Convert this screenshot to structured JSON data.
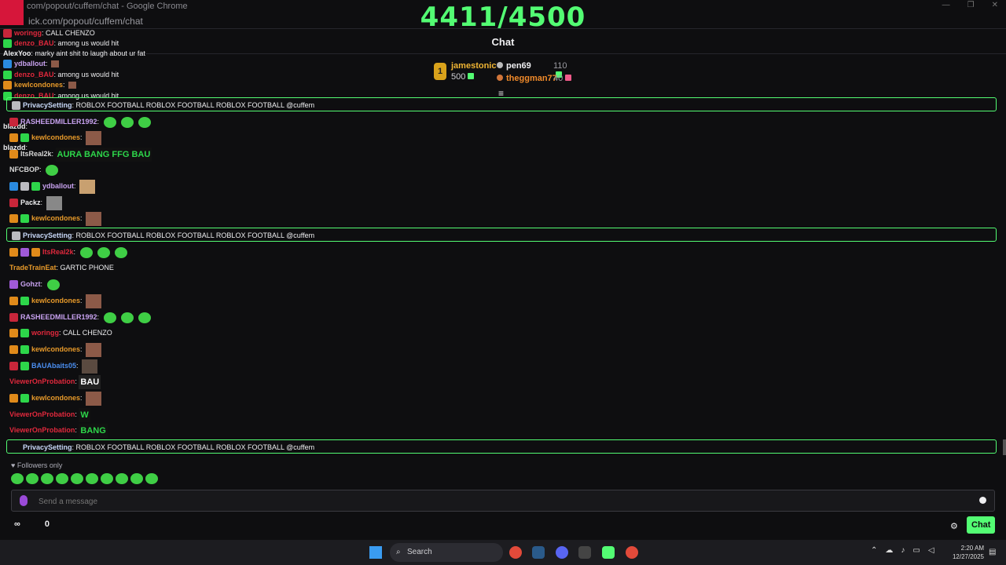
{
  "browser": {
    "title": "com/popout/cuffem/chat - Google Chrome",
    "address": "ick.com/popout/cuffem/chat",
    "window_controls": [
      "—",
      "❐",
      "✕"
    ]
  },
  "overlay": {
    "counter": "4411/4500"
  },
  "header": {
    "title": "Chat"
  },
  "leaderboard": {
    "first": {
      "rank": "1",
      "name": "jamestonic",
      "amount": "500"
    },
    "second": {
      "name": "pen69",
      "amount": "110"
    },
    "third": {
      "name": "theggman77",
      "amount": "40"
    },
    "expand_icon": "≡"
  },
  "overlay_chat": [
    {
      "name": "woringg",
      "text": "CALL CHENZO"
    },
    {
      "name": "denzo_BAU",
      "text": "among us would hit"
    },
    {
      "name": "AlexYoo",
      "text": "marky aint shit to laugh about ur fat"
    },
    {
      "name": "ydballout",
      "text": ""
    },
    {
      "name": "denzo_BAU",
      "text": "among us would hit"
    },
    {
      "name": "kewlcondones",
      "text": ""
    },
    {
      "name": "denzo_BAU",
      "text": "among us would hit"
    },
    {
      "name": "RASHEEDMILLER1992",
      "text": ""
    },
    {
      "name": "blazdd",
      "text": ""
    },
    {
      "name": "blazdd",
      "text": ""
    },
    {
      "name": "NFCBOP",
      "text": ""
    }
  ],
  "chat": {
    "pinned_text": "ROBLOX FOOTBALL ROBLOX FOOTBALL ROBLOX FOOTBALL @cuffem",
    "messages": [
      {
        "name": "RASHEEDMILLER1992",
        "color": "#c8a2f0",
        "text": ""
      },
      {
        "name": "kewlcondones",
        "color": "#e89a2a",
        "text": ""
      },
      {
        "name": "ItsReal2k",
        "color": "#d8d8d8",
        "text": "AURA BANG FFG BAU"
      },
      {
        "name": "NFCBOP",
        "color": "#d8d8d8",
        "text": ""
      },
      {
        "name": "ydballout",
        "color": "#c8a2f0",
        "text": ""
      },
      {
        "name": "Packz",
        "color": "#efeff1",
        "text": ""
      },
      {
        "name": "kewlcondones",
        "color": "#e89a2a",
        "text": ""
      },
      {
        "name": "PrivacySetting",
        "color": "#c8d8f8",
        "text": "ROBLOX FOOTBALL ROBLOX FOOTBALL ROBLOX FOOTBALL @cuffem"
      },
      {
        "name": "ItsReal2k",
        "color": "#e0283c",
        "text": ""
      },
      {
        "name": "TradeTrainEat",
        "color": "#e89a2a",
        "text": "GARTIC PHONE"
      },
      {
        "name": "Gohzt",
        "color": "#c8a2f0",
        "text": ""
      },
      {
        "name": "kewlcondones",
        "color": "#e89a2a",
        "text": ""
      },
      {
        "name": "RASHEEDMILLER1992",
        "color": "#c8a2f0",
        "text": ""
      },
      {
        "name": "woringg",
        "color": "#e0283c",
        "text": "CALL CHENZO"
      },
      {
        "name": "kewlcondones",
        "color": "#e89a2a",
        "text": ""
      },
      {
        "name": "BAUAbaits05",
        "color": "#4a8ef0",
        "text": ""
      },
      {
        "name": "ViewerOnProbation",
        "color": "#e0283c",
        "text": ""
      },
      {
        "name": "kewlcondones",
        "color": "#e89a2a",
        "text": ""
      },
      {
        "name": "ViewerOnProbation",
        "color": "#e0283c",
        "text": ""
      },
      {
        "name": "ViewerOnProbation",
        "color": "#e0283c",
        "text": ""
      }
    ],
    "text_emotes": {
      "bau": "BAU",
      "w": "W",
      "bang": "BANG"
    }
  },
  "footer": {
    "followers_only": "Followers only",
    "input_placeholder": "Send a message",
    "viewers_icon": "∞",
    "gift_count": "0",
    "chat_button": "Chat",
    "gear_icon": "⚙"
  },
  "taskbar": {
    "search_label": "Search",
    "time": "2:20 AM",
    "date": "12/27/2025"
  },
  "colors": {
    "accent": "#53fc73",
    "background": "#0e0e10"
  }
}
